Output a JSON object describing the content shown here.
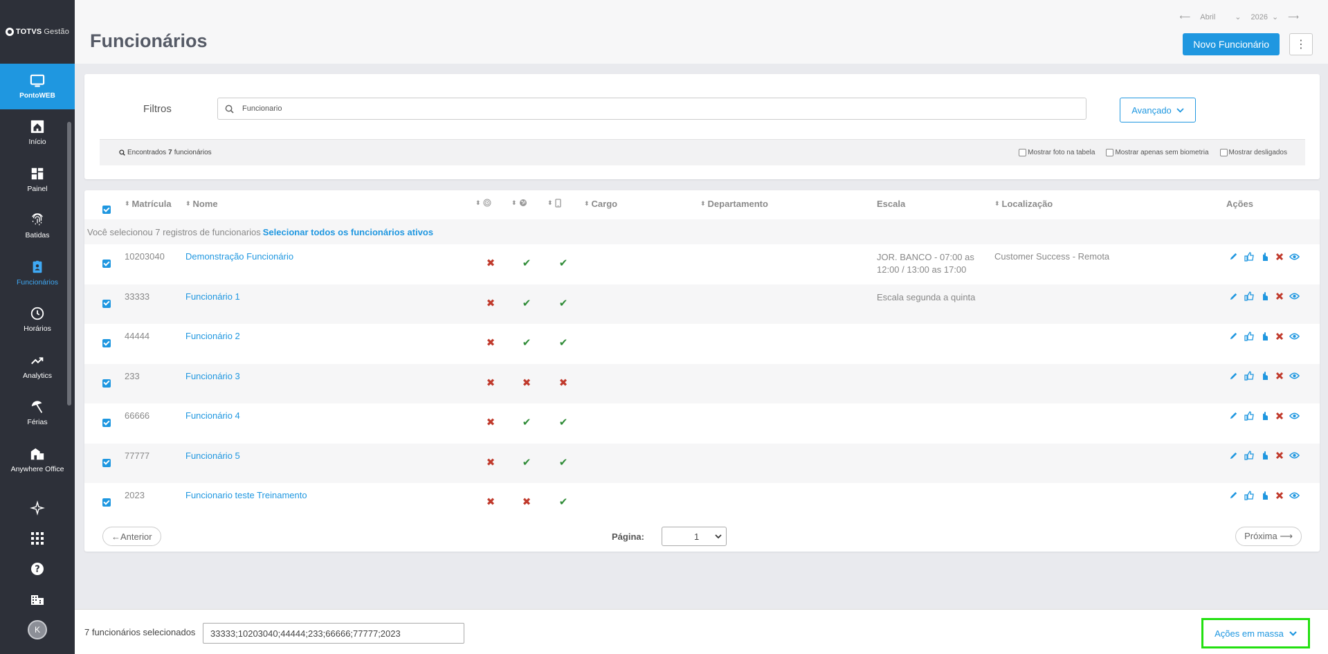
{
  "brand": {
    "name": "TOTVS",
    "suffix": "Gestão"
  },
  "module": {
    "label": "PontoWEB"
  },
  "nav": [
    {
      "label": "Início",
      "icon": "home-icon",
      "active": false
    },
    {
      "label": "Painel",
      "icon": "dashboard-icon",
      "active": false
    },
    {
      "label": "Batidas",
      "icon": "fingerprint-icon",
      "active": false
    },
    {
      "label": "Funcionários",
      "icon": "badge-icon",
      "active": true
    },
    {
      "label": "Horários",
      "icon": "clock-icon",
      "active": false
    },
    {
      "label": "Analytics",
      "icon": "trend-icon",
      "active": false
    },
    {
      "label": "Férias",
      "icon": "beach-umbrella-icon",
      "active": false
    },
    {
      "label": "Anywhere Office",
      "icon": "office-icon",
      "active": false
    }
  ],
  "user": {
    "initial": "K"
  },
  "header": {
    "title": "Funcionários",
    "month": "Abril",
    "year": "2026",
    "new_button": "Novo Funcionário",
    "more_button": "⋮"
  },
  "filters": {
    "label": "Filtros",
    "search_value": "Funcionario",
    "advanced_button": "Avançado",
    "found_prefix": "Encontrados",
    "found_count": "7",
    "found_suffix": "funcionários",
    "opt_photo": "Mostrar foto na tabela",
    "opt_no_bio": "Mostrar apenas sem biometria",
    "opt_disabled": "Mostrar desligados"
  },
  "table": {
    "columns": {
      "matricula": "Matrícula",
      "nome": "Nome",
      "cargo": "Cargo",
      "departamento": "Departamento",
      "escala": "Escala",
      "localizacao": "Localização",
      "acoes": "Ações"
    },
    "notice_text": "Você selecionou 7 registros de funcionarios",
    "notice_link": "Selecionar todos os funcionários ativos",
    "rows": [
      {
        "matricula": "10203040",
        "nome": "Demonstração Funcionário",
        "bio": false,
        "web": true,
        "mobile": true,
        "escala": "JOR. BANCO - 07:00 as 12:00 / 13:00 as 17:00",
        "localizacao": "Customer Success - Remota"
      },
      {
        "matricula": "33333",
        "nome": "Funcionário 1",
        "bio": false,
        "web": true,
        "mobile": true,
        "escala": "Escala segunda a quinta",
        "localizacao": ""
      },
      {
        "matricula": "44444",
        "nome": "Funcionário 2",
        "bio": false,
        "web": true,
        "mobile": true,
        "escala": "",
        "localizacao": ""
      },
      {
        "matricula": "233",
        "nome": "Funcionário 3",
        "bio": false,
        "web": false,
        "mobile": false,
        "escala": "",
        "localizacao": ""
      },
      {
        "matricula": "66666",
        "nome": "Funcionário 4",
        "bio": false,
        "web": true,
        "mobile": true,
        "escala": "",
        "localizacao": ""
      },
      {
        "matricula": "77777",
        "nome": "Funcionário 5",
        "bio": false,
        "web": true,
        "mobile": true,
        "escala": "",
        "localizacao": ""
      },
      {
        "matricula": "2023",
        "nome": "Funcionario teste Treinamento",
        "bio": false,
        "web": false,
        "mobile": true,
        "escala": "",
        "localizacao": ""
      }
    ]
  },
  "pager": {
    "prev": "←Anterior",
    "label": "Página:",
    "current": "1",
    "next": "Próxima ⟶"
  },
  "footer": {
    "selected_count": "7 funcionários selecionados",
    "selected_ids": "33333;10203040;44444;233;66666;77777;2023",
    "bulk_button": "Ações em massa"
  },
  "colors": {
    "accent": "#1f97e0",
    "sidebar": "#2d3039",
    "ok": "#2e8b36",
    "error": "#c0392b",
    "highlight": "#22e00f"
  }
}
